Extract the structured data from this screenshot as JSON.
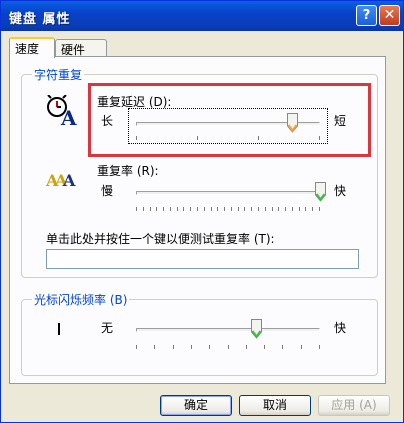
{
  "window": {
    "title": "键盘 属性"
  },
  "titlebar": {
    "help_glyph": "?",
    "close_glyph": "✕"
  },
  "tabs": [
    {
      "label": "速度"
    },
    {
      "label": "硬件"
    }
  ],
  "char_repeat": {
    "legend": "字符重复",
    "delay": {
      "label": "重复延迟 (D):",
      "left": "长",
      "right": "短",
      "value": 0.85
    },
    "rate": {
      "label": "重复率 (R):",
      "left": "慢",
      "right": "快",
      "value": 1.0
    },
    "test_label": "单击此处并按住一个键以便测试重复率 (T):",
    "test_value": ""
  },
  "cursor_blink": {
    "legend": "光标闪烁频率 (B)",
    "left": "无",
    "right": "快",
    "value": 0.65
  },
  "buttons": {
    "ok": "确定",
    "cancel": "取消",
    "apply": "应用 (A)"
  },
  "colors": {
    "title_bar": "#0a3cb8",
    "highlight_box": "#d9363e",
    "group_legend": "#0046d5"
  }
}
